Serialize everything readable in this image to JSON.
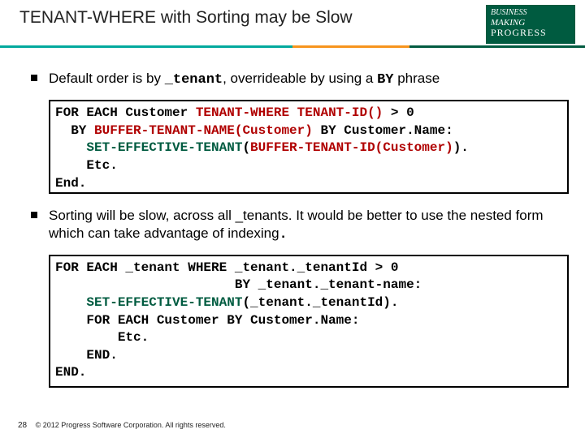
{
  "header": {
    "title": "TENANT-WHERE with Sorting may be Slow",
    "logo": {
      "line1": "BUSINESS",
      "line2": "MAKING",
      "line3": "PROGRESS"
    }
  },
  "bullets": {
    "b1_pre": "Default order is by ",
    "b1_mono1": "_tenant",
    "b1_mid": ", overrideable by using a ",
    "b1_mono2": "BY",
    "b1_post": " phrase",
    "b2": "Sorting will be slow, across all _tenants.  It would be better to use the nested form which can take advantage of indexing",
    "b2_dot": "."
  },
  "code1": {
    "l1a": "FOR EACH Customer ",
    "l1b": "TENANT-WHERE",
    "l1c": " ",
    "l1d": "TENANT-ID()",
    "l1e": " > 0",
    "l2a": "  BY ",
    "l2b": "BUFFER-TENANT-NAME(Customer)",
    "l2c": " BY Customer.Name:",
    "l3a": "    ",
    "l3b": "SET-EFFECTIVE-TENANT",
    "l3c": "(",
    "l3d": "BUFFER-TENANT-ID(Customer)",
    "l3e": ").",
    "l4": "    Etc.",
    "l5": "End."
  },
  "code2": {
    "l1": "FOR EACH _tenant WHERE _tenant._tenantId > 0",
    "l2": "                       BY _tenant._tenant-name:",
    "l3a": "    ",
    "l3b": "SET-EFFECTIVE-TENANT",
    "l3c": "(_tenant._tenantId).",
    "l4": "    FOR EACH Customer BY Customer.Name:",
    "l5": "        Etc.",
    "l6": "    END.",
    "l7": "END."
  },
  "footer": {
    "page": "28",
    "copyright": "© 2012 Progress Software Corporation. All rights reserved."
  }
}
